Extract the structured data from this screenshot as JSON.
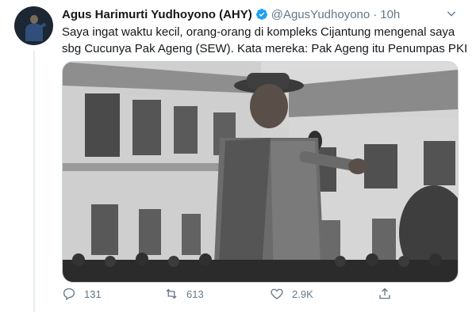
{
  "tweet": {
    "author_name": "Agus Harimurti Yudhoyono (AHY)",
    "handle": "@AgusYudhoyono",
    "separator": "·",
    "time": "10h",
    "text_lines": [
      "Saya ingat waktu kecil, orang-orang di kompleks Cijantung mengenal saya",
      "sbg Cucunya Pak Ageng (SEW). Kata mereka: Pak Ageng itu Penumpas PKI"
    ],
    "media_description_icon": "black-and-white-photo",
    "actions": {
      "reply_count": "131",
      "retweet_count": "613",
      "like_count": "2.9K"
    }
  },
  "icons": {
    "verified": "verified-badge-icon",
    "caret": "chevron-down-icon",
    "reply": "reply-icon",
    "retweet": "retweet-icon",
    "like": "heart-icon",
    "share": "share-icon"
  },
  "colors": {
    "accent": "#1da1f2",
    "muted": "#657786",
    "text": "#14171a",
    "border": "#ccd6dd"
  }
}
